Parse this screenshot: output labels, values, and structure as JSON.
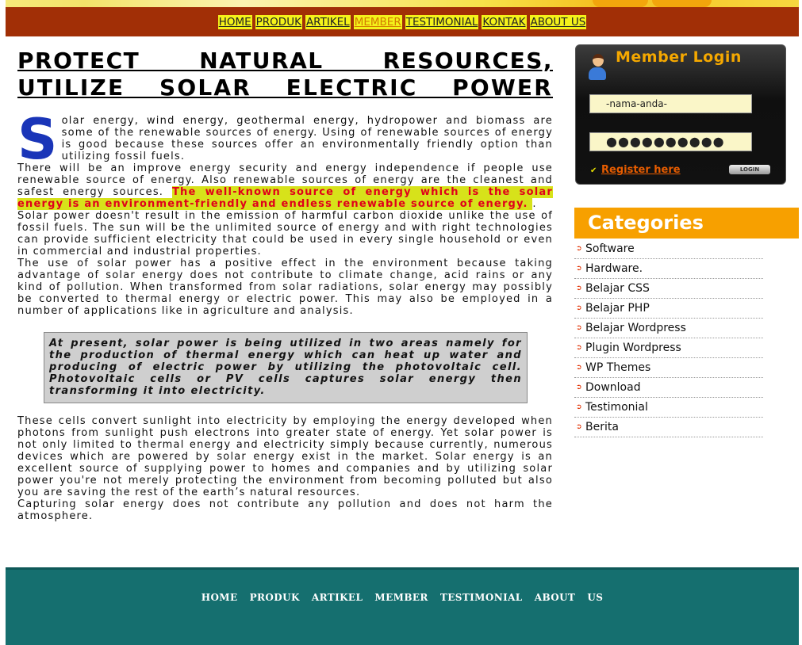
{
  "nav": {
    "items": [
      "HOME",
      "PRODUK",
      "ARTIKEL",
      "MEMBER",
      "TESTIMONIAL",
      "KONTAK",
      "ABOUT US"
    ],
    "active": "MEMBER"
  },
  "article": {
    "title_line1": "PROTECT NATURAL RESOURCES,",
    "title_line2": "UTILIZE SOLAR ELECTRIC POWER",
    "dropcap": "S",
    "p1": "olar energy, wind energy, geothermal energy, hydropower and biomass are some of the renewable sources of energy. Using of renewable sources of energy is good because these sources offer an environmentally friendly option than utilizing fossil fuels.",
    "p2_start": "There will be an improve energy security and energy independence if people use renewable source of energy. Also renewable sources of energy are the cleanest and safest energy sources. ",
    "p2_highlight": "The well-known source of energy which is the solar energy is an environment-friendly and endless renewable source of energy. ",
    "p2_end": ".",
    "p3": "Solar power doesn't result in the emission of harmful carbon dioxide unlike the use of fossil fuels. The sun will be the unlimited source of energy and with right technologies can provide sufficient electricity that could be used in every single household or even in commercial and industrial properties.",
    "p4": "The use of solar power has a positive effect in the environment because taking advantage of solar energy does not contribute to climate change, acid rains or any kind of pollution. When transformed from solar radiations, solar energy may possibly be converted to thermal energy or electric power. This may also be employed in a number of applications like in agriculture and analysis.",
    "quote": "At present, solar power is being utilized in two areas namely for the production of thermal energy which can heat up water and producing of electric power by utilizing the photovoltaic cell. Photovoltaic cells or PV cells captures solar energy then transforming it into electricity.",
    "p5": "These cells convert sunlight into electricity by employing the energy developed when photons from sunlight push electrons into greater state of energy. Yet solar power is not only limited to thermal energy and electricity simply because currently, numerous devices which are powered by solar energy exist in the market. Solar energy is an excellent source of supplying power to homes and companies and by utilizing solar power you're not merely protecting the environment from becoming polluted but also you are saving the rest of the earth’s natural resources.",
    "p6": "Capturing solar energy does not contribute any pollution and does not harm the atmosphere."
  },
  "login": {
    "title": "Member Login",
    "username_placeholder": "-nama-anda-",
    "password_value": "●●●●●●●●●●",
    "register_label": "Register here",
    "login_button": "LOGIN"
  },
  "categories": {
    "title": "Categories",
    "items": [
      "Software",
      "Hardware.",
      "Belajar CSS",
      "Belajar PHP",
      "Belajar Wordpress",
      "Plugin Wordpress",
      "WP Themes",
      "Download",
      "Testimonial",
      "Berita"
    ]
  },
  "footer": {
    "items": [
      "HOME",
      "PRODUK",
      "ARTIKEL",
      "MEMBER",
      "TESTIMONIAL",
      "ABOUT",
      "US"
    ]
  },
  "colors": {
    "nav_bg": "#a12f06",
    "nav_item_bg": "#f4f21a",
    "accent_orange": "#f7a000",
    "footer_bg": "#156f6f",
    "dropcap": "#1a35b8",
    "highlight_text": "#e0001a"
  }
}
